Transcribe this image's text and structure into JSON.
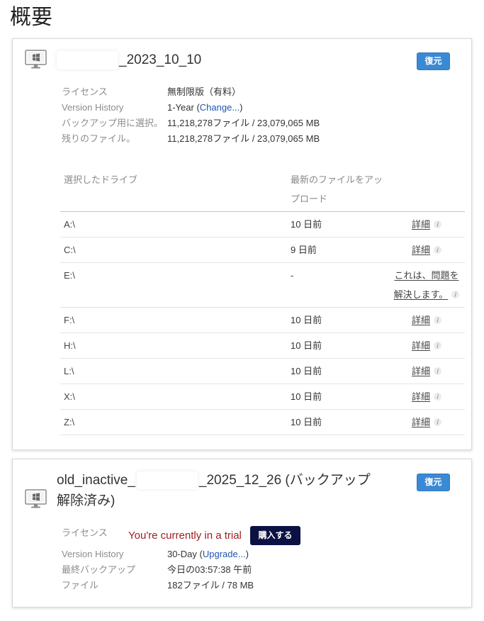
{
  "page": {
    "title": "概要"
  },
  "colors": {
    "restore_button": "#3a89d5",
    "buy_button": "#0b1143",
    "link": "#1f56ae",
    "trial_text": "#a31c22"
  },
  "icons": {
    "computer": "computer-icon",
    "info": "info-icon"
  },
  "computer1": {
    "name_suffix": "_2023_10_10",
    "restore_label": "復元",
    "info": {
      "license_label": "ライセンス",
      "license_value": "無制限版（有料）",
      "version_label": "Version History",
      "version_prefix": "1-Year (",
      "version_link": "Change...",
      "version_suffix": ")",
      "selected_label": "バックアップ用に選択。",
      "selected_value": "11,218,278ファイル / 23,079,065 MB",
      "remaining_label": "残りのファイル。",
      "remaining_value": "11,218,278ファイル / 23,079,065 MB"
    },
    "drives": {
      "header_drive": "選択したドライブ",
      "header_last_upload": "最新のファイルをアップロード",
      "rows": [
        {
          "drive": "A:\\",
          "last_upload": "10 日前",
          "action": "詳細"
        },
        {
          "drive": "C:\\",
          "last_upload": "9 日前",
          "action": "詳細"
        },
        {
          "drive": "E:\\",
          "last_upload": "-",
          "action": "これは、問題を解決します。"
        },
        {
          "drive": "F:\\",
          "last_upload": "10 日前",
          "action": "詳細"
        },
        {
          "drive": "H:\\",
          "last_upload": "10 日前",
          "action": "詳細"
        },
        {
          "drive": "L:\\",
          "last_upload": "10 日前",
          "action": "詳細"
        },
        {
          "drive": "X:\\",
          "last_upload": "10 日前",
          "action": "詳細"
        },
        {
          "drive": "Z:\\",
          "last_upload": "10 日前",
          "action": "詳細"
        }
      ]
    }
  },
  "computer2": {
    "name_prefix": "old_inactive_",
    "name_suffix": "_2025_12_26 (バックアップ解除済み)",
    "restore_label": "復元",
    "info": {
      "license_label": "ライセンス",
      "trial_text": "You're currently in a trial",
      "buy_label": "購入する",
      "version_label": "Version History",
      "version_prefix": "30-Day (",
      "version_link": "Upgrade...",
      "version_suffix": ")",
      "last_backup_label": "最終バックアップ",
      "last_backup_value": "今日の03:57:38 午前",
      "files_label": "ファイル",
      "files_value": "182ファイル / 78 MB"
    }
  }
}
